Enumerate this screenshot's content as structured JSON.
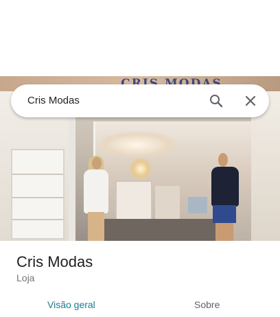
{
  "photo": {
    "storefront_sign": "CRIS MODAS",
    "description_icon": "storefront-photo"
  },
  "search": {
    "query": "Cris Modas",
    "search_icon": "search-icon",
    "close_icon": "close-icon"
  },
  "place": {
    "title": "Cris Modas",
    "category": "Loja"
  },
  "tabs": [
    {
      "label": "Visão geral",
      "selected": true
    },
    {
      "label": "Sobre",
      "selected": false
    }
  ],
  "colors": {
    "accent": "#1a7c8c",
    "text_primary": "#202124",
    "text_secondary": "#70757a",
    "icon": "#5f6368"
  }
}
